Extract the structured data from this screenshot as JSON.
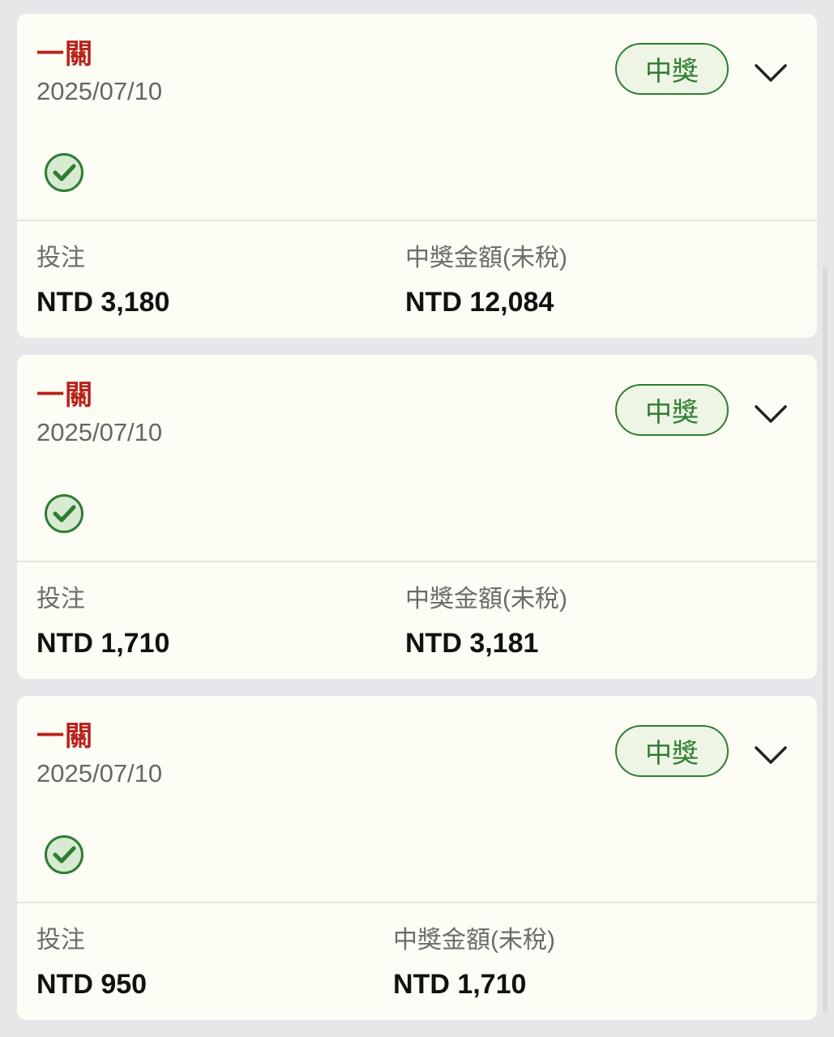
{
  "colors": {
    "page_background": "#e6e7e9",
    "card_background": "#fdfdf5",
    "bet_type": "#b8231b",
    "badge_green": "#2e7d32",
    "badge_fill": "#eef5e4"
  },
  "icons": {
    "expand": "chevron-down-icon",
    "result": "check-circle-icon"
  },
  "cards": [
    {
      "bet_type": "一關",
      "date": "2025/07/10",
      "status": "中獎",
      "stake_label": "投注",
      "stake_value": "NTD 3,180",
      "payout_label": "中獎金額(未稅)",
      "payout_value": "NTD 12,084"
    },
    {
      "bet_type": "一關",
      "date": "2025/07/10",
      "status": "中獎",
      "stake_label": "投注",
      "stake_value": "NTD 1,710",
      "payout_label": "中獎金額(未稅)",
      "payout_value": "NTD 3,181"
    },
    {
      "bet_type": "一關",
      "date": "2025/07/10",
      "status": "中獎",
      "stake_label": "投注",
      "stake_value": "NTD 950",
      "payout_label": "中獎金額(未稅)",
      "payout_value": "NTD 1,710"
    }
  ]
}
